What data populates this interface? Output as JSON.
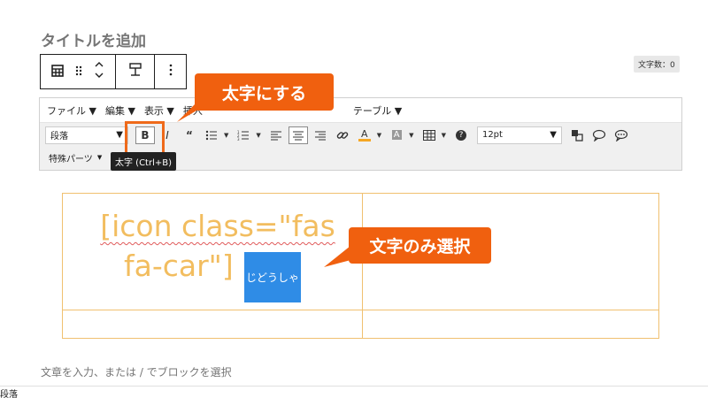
{
  "post": {
    "title_placeholder": "タイトルを追加",
    "char_count": "文字数：0",
    "paragraph_placeholder": "文章を入力、または / でブロックを選択"
  },
  "block_toolbar": {
    "icons": [
      "table-icon",
      "drag-handle-icon",
      "move-up-down-icon",
      "align-icon",
      "more-options-icon"
    ]
  },
  "editor": {
    "menus": [
      "ファイル ▼",
      "編集 ▼",
      "表示 ▼",
      "挿入",
      "テーブル ▼"
    ],
    "format_select": "段落",
    "font_size_select": "12pt",
    "special_parts": "特殊パーツ",
    "bold_tooltip": "太字 (Ctrl+B)",
    "accent_color": "#ef6a1a",
    "text_color_underline": "#f5a623"
  },
  "annotations": {
    "bold_callout": "太字にする",
    "select_callout": "文字のみ選択",
    "callout_color": "#f0600f"
  },
  "table": {
    "cell_line1": "[icon class=\"fas",
    "cell_line2": "fa-car\"]",
    "selected_text": "じどうしゃ",
    "selection_color": "#2f8ce6",
    "text_color": "#f2bd5f"
  },
  "status_bar": {
    "path": "段落"
  }
}
